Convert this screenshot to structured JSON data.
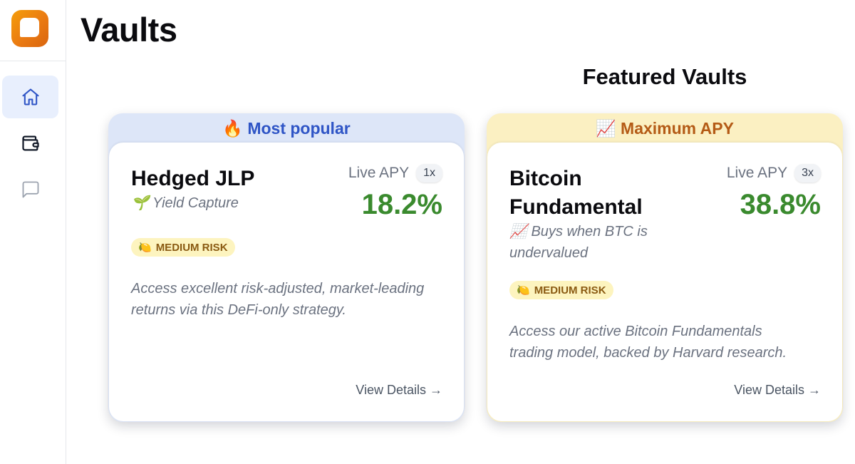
{
  "page": {
    "title": "Vaults"
  },
  "sidebar": {
    "items": [
      {
        "icon": "home-icon",
        "active": true
      },
      {
        "icon": "wallet-icon",
        "active": false
      },
      {
        "icon": "chat-icon",
        "active": false
      }
    ]
  },
  "featured": {
    "title": "Featured Vaults",
    "vaults": [
      {
        "banner_emoji": "🔥",
        "banner_label": "Most popular",
        "name": "Hedged JLP",
        "tag_emoji": "🌱",
        "tag": "Yield Capture",
        "live_label": "Live APY",
        "leverage": "1x",
        "apy": "18.2%",
        "risk_emoji": "🍋",
        "risk": "MEDIUM RISK",
        "description": "Access excellent risk-adjusted, market-leading returns via this DeFi-only strategy.",
        "cta": "View Details →"
      },
      {
        "banner_emoji": "📈",
        "banner_label": "Maximum APY",
        "name": "Bitcoin Fundamental",
        "tag_emoji": "📈",
        "tag": "Buys when BTC is undervalued",
        "live_label": "Live APY",
        "leverage": "3x",
        "apy": "38.8%",
        "risk_emoji": "🍋",
        "risk": "MEDIUM RISK",
        "description": "Access our active Bitcoin Fundamentals trading model, backed by Harvard research.",
        "cta": "View Details →"
      }
    ]
  },
  "colors": {
    "accent_blue": "#2f55c6",
    "accent_orange": "#b45b16",
    "apy_green": "#3a8a2e",
    "risk_bg": "#fdf4bf"
  }
}
